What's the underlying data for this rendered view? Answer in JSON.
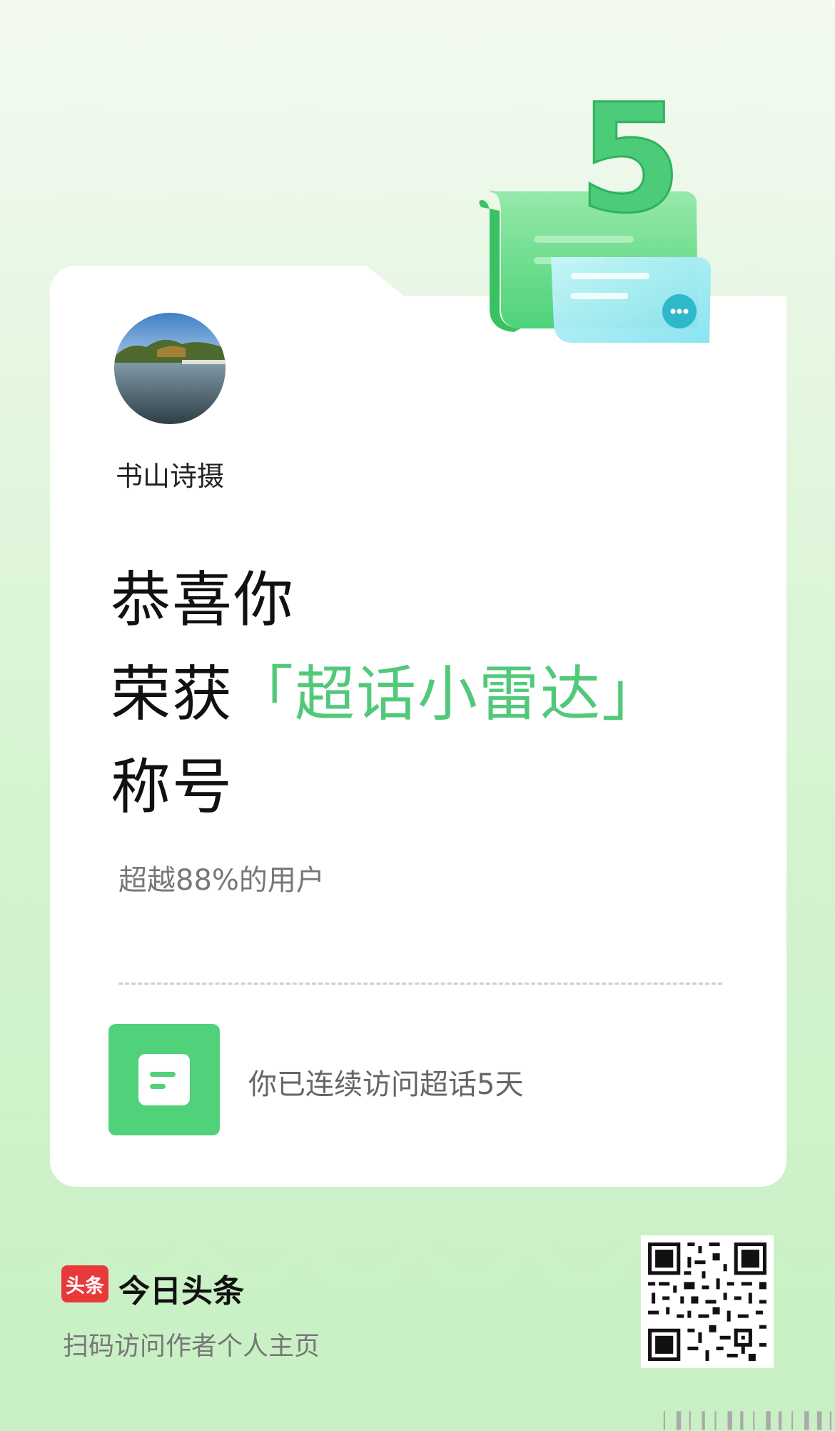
{
  "badge": {
    "day_count": "5"
  },
  "profile": {
    "username": "书山诗摄"
  },
  "award": {
    "line1": "恭喜你",
    "line2_prefix": "荣获",
    "title": "「超话小雷达」",
    "line3": "称号",
    "percent_text": "超越88%的用户"
  },
  "streak": {
    "text": "你已连续访问超话5天"
  },
  "footer": {
    "brand_logo": "头条",
    "brand_name": "今日头条",
    "scan_hint": "扫码访问作者个人主页"
  },
  "colors": {
    "accent": "#52c97a",
    "icon_green": "#4fd27a",
    "brand_red": "#e8393a"
  }
}
